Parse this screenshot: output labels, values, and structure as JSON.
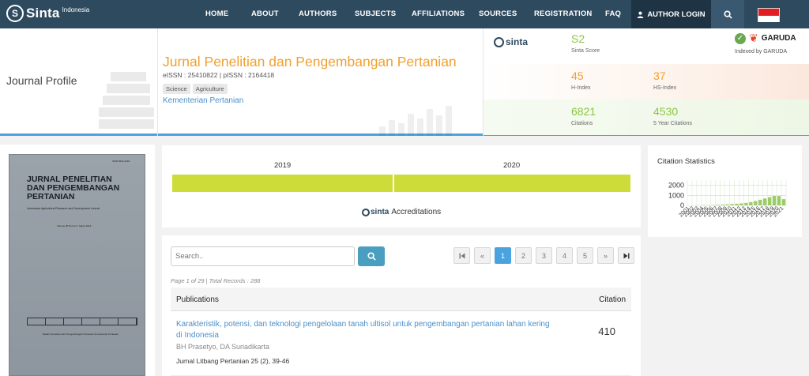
{
  "nav": {
    "brand": "Sinta",
    "country": "Indonesia",
    "items": [
      "HOME",
      "ABOUT",
      "AUTHORS",
      "SUBJECTS",
      "AFFILIATIONS",
      "SOURCES",
      "REGISTRATION",
      "FAQ"
    ],
    "login_label": "AUTHOR LOGIN",
    "search_icon": "search-icon",
    "flag": "indonesia-flag"
  },
  "header": {
    "section_label": "Journal Profile",
    "title": "Jurnal Penelitian dan Pengembangan Pertanian",
    "issn": "eISSN : 25410822 | pISSN : 2164418",
    "tags": [
      "Science",
      "Agriculture"
    ],
    "publisher": "Kementerian Pertanian"
  },
  "stats": {
    "logo": "sinta",
    "sinta_score": {
      "value": "S2",
      "label": "Sinta Score"
    },
    "garuda": {
      "name": "GARUDA",
      "label": "Indexed by GARUDA"
    },
    "h_index": {
      "value": "45",
      "label": "H-Index"
    },
    "hs_index": {
      "value": "37",
      "label": "HS-Index"
    },
    "citations": {
      "value": "6821",
      "label": "Citations"
    },
    "five_year": {
      "value": "4530",
      "label": "5 Year Citations"
    }
  },
  "cover": {
    "title_lines": [
      "JURNAL PENELITIAN",
      "DAN PENGEMBANGAN",
      "PERTANIAN"
    ],
    "subtitle": "Indonesian Agricultural Research and Development Journal",
    "issue": "Volume 35 Nomor 1, Maret 2016",
    "footer": "Badan Penelitian dan Pengembangan Pertanian Kementerian Pertanian"
  },
  "accreditation": {
    "years": [
      "2019",
      "2020"
    ],
    "label": "Accreditations",
    "bar_color": "#cddc39"
  },
  "citation_stats": {
    "title": "Citation Statistics"
  },
  "chart_data": {
    "type": "bar",
    "title": "Citation Statistics",
    "categories": [
      "2001",
      "2002",
      "2003",
      "2004",
      "2005",
      "2006",
      "2007",
      "2008",
      "2009",
      "2010",
      "2011",
      "2012",
      "2013",
      "2014",
      "2015",
      "2016",
      "2017",
      "2018",
      "2019",
      "2020",
      "2021"
    ],
    "values": [
      0,
      0,
      10,
      20,
      30,
      40,
      60,
      80,
      100,
      130,
      160,
      200,
      250,
      330,
      430,
      560,
      690,
      820,
      940,
      930,
      620
    ],
    "yticks": [
      "0",
      "1000",
      "2000"
    ],
    "ylim": [
      0,
      2200
    ],
    "grid": true
  },
  "publications": {
    "search_placeholder": "Search..",
    "pages": [
      "1",
      "2",
      "3",
      "4",
      "5"
    ],
    "active_page": "1",
    "page_info": "Page 1 of 29 | Total Records : 288",
    "col_publications": "Publications",
    "col_citation": "Citation",
    "rows": [
      {
        "title": "Karakteristik, potensi, dan teknologi pengelolaan tanah ultisol untuk pengembangan pertanian lahan kering di Indonesia",
        "authors": "BH Prasetyo, DA Suriadikarta",
        "venue": "Jurnal Litbang Pertanian 25 (2), 39-46",
        "citation": "410"
      }
    ]
  }
}
